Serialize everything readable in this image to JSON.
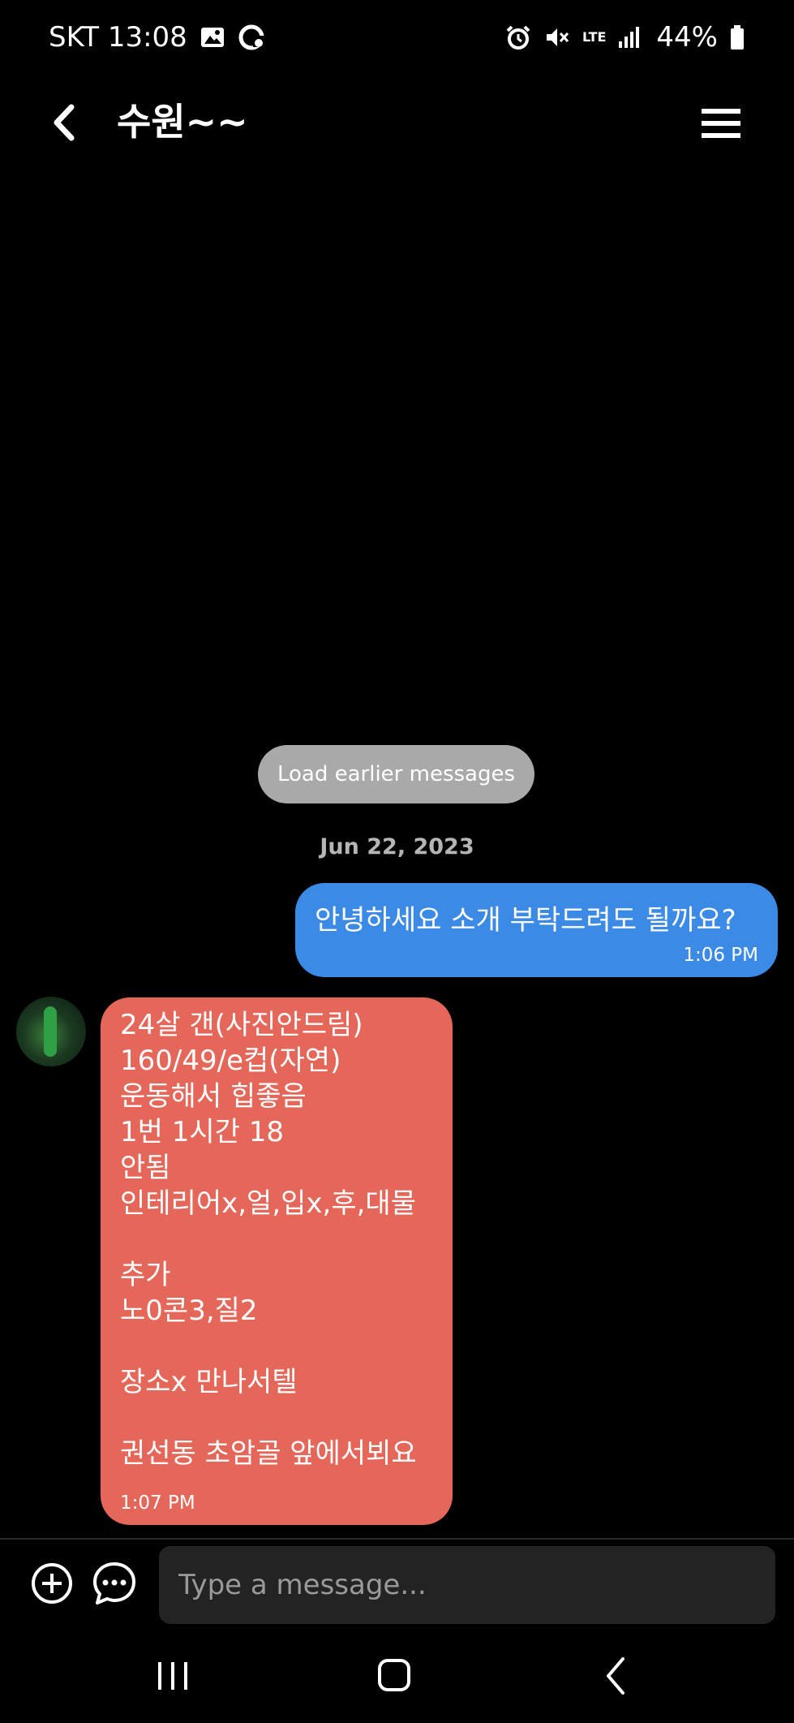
{
  "status_bar": {
    "carrier_time": "SKT 13:08",
    "battery": "44%",
    "network": "LTE"
  },
  "header": {
    "title": "수원~~"
  },
  "chat": {
    "load_earlier_label": "Load earlier messages",
    "date": "Jun 22, 2023",
    "outgoing": {
      "text": "안녕하세요 소개 부탁드려도 될까요?",
      "time": "1:06 PM"
    },
    "incoming": {
      "lines": [
        "24살 갠(사진안드림)",
        "160/49/e컵(자연)",
        "운동해서 힙좋음",
        "1번 1시간 18",
        "안됨",
        "인테리어x,얼,입x,후,대물",
        "",
        "추가",
        "노0콘3,질2",
        "",
        "장소x 만나서텔",
        "",
        "권선동 초암골 앞에서뵈요"
      ],
      "time": "1:07 PM"
    }
  },
  "composer": {
    "placeholder": "Type a message..."
  },
  "colors": {
    "outgoing_bubble": "#3b8ae6",
    "incoming_bubble": "#e4675a",
    "background": "#000000"
  },
  "icons": [
    "image-icon",
    "sync-icon",
    "alarm-icon",
    "mute-icon",
    "signal-icon",
    "battery-icon",
    "back-arrow-icon",
    "menu-icon",
    "plus-circle-icon",
    "chat-bubble-icon",
    "recents-icon",
    "home-icon",
    "nav-back-icon"
  ]
}
